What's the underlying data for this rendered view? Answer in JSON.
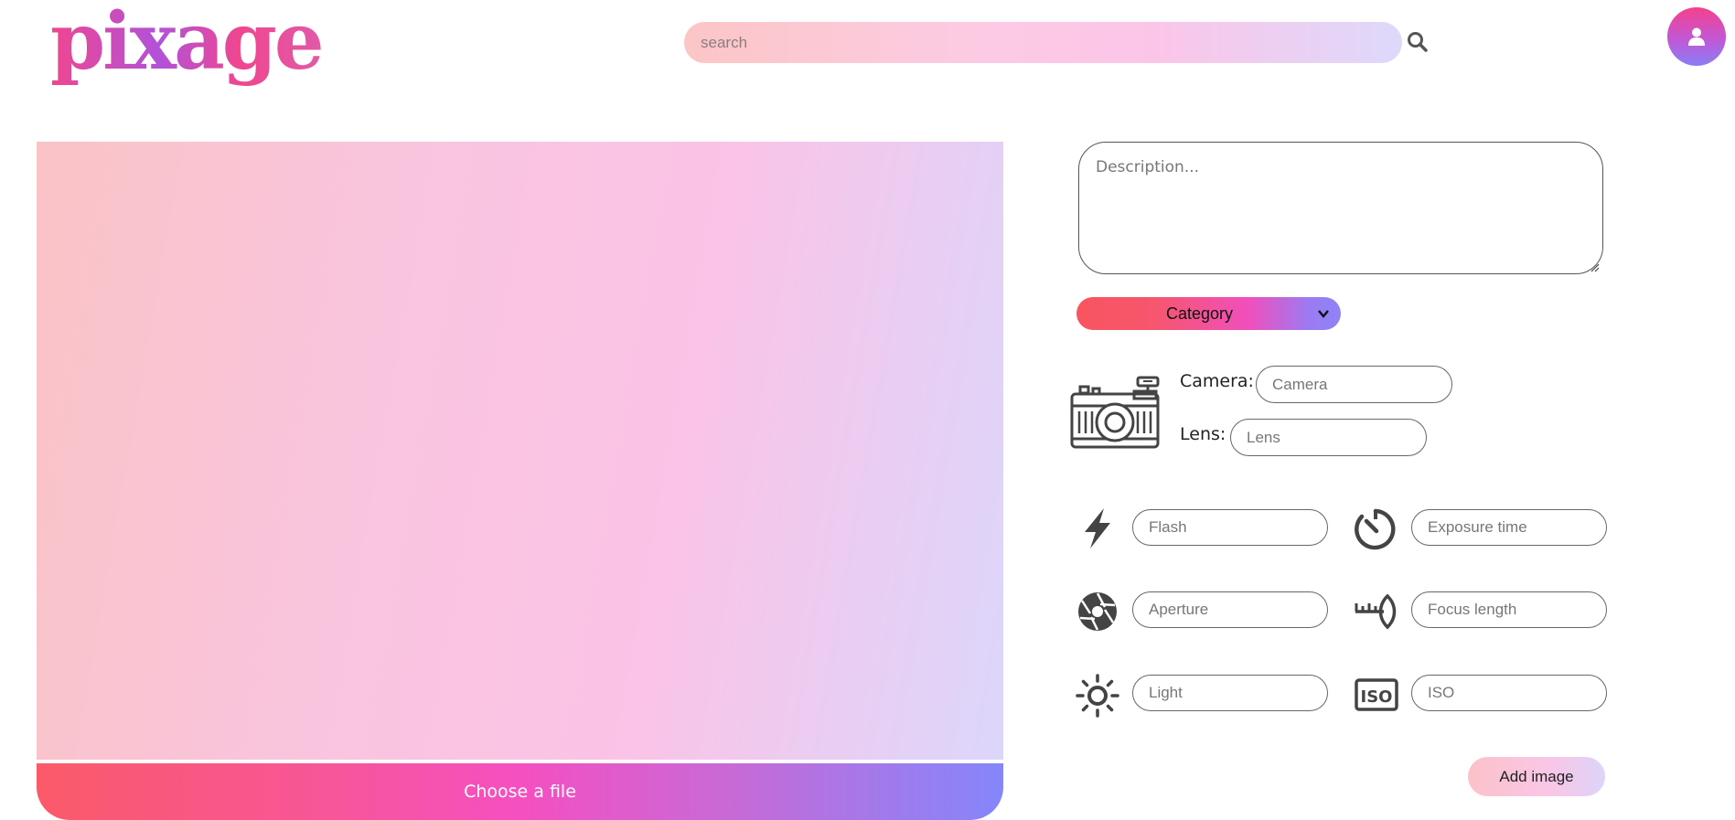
{
  "header": {
    "logo": "pixage",
    "search": {
      "placeholder": "search",
      "value": ""
    }
  },
  "upload": {
    "choose_file_label": "Choose a file"
  },
  "form": {
    "description": {
      "placeholder": "Description..."
    },
    "category": {
      "label": "Category"
    },
    "camera": {
      "label": "Camera:",
      "placeholder": "Camera"
    },
    "lens": {
      "label": "Lens:",
      "placeholder": "Lens"
    },
    "flash": {
      "placeholder": "Flash"
    },
    "exposure_time": {
      "placeholder": "Exposure time"
    },
    "aperture": {
      "placeholder": "Aperture"
    },
    "focus_length": {
      "placeholder": "Focus length"
    },
    "light": {
      "placeholder": "Light"
    },
    "iso": {
      "placeholder": "ISO",
      "icon_text": "ISO"
    },
    "submit_label": "Add image"
  },
  "icons": {
    "search": "search-icon",
    "avatar": "user-icon",
    "camera": "camera-icon",
    "flash": "lightning-icon",
    "exposure": "timer-icon",
    "aperture": "aperture-icon",
    "focus": "focus-length-icon",
    "light": "sun-icon",
    "iso": "iso-icon"
  },
  "colors": {
    "brand_pink": "#f0468f",
    "brand_purple": "#8486fb",
    "icon_gray": "#444444"
  }
}
